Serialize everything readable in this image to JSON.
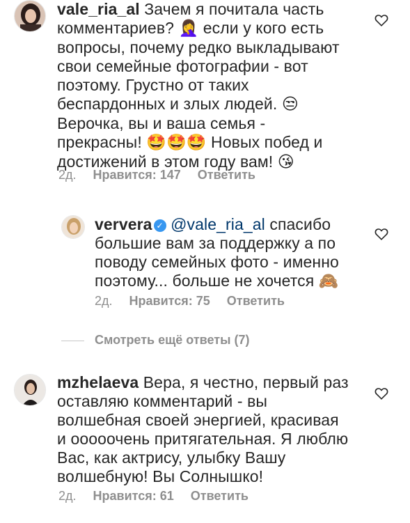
{
  "comments": [
    {
      "username": "vale_ria_al",
      "lines": [
        " Зачем я почитала часть",
        "комментариев? ",
        "вопросы, почему редко выкладывают",
        "свои семейные фотографии - вот",
        "поэтому. Грустно от таких",
        "беспардонных и злых людей. ",
        "Верочка, вы и ваша семья -",
        "прекрасны! ",
        "достижений в этом году вам! "
      ],
      "inline": {
        "line2_after_emoji": " если у кого есть",
        "line8_after_emoji": " Новых побед и"
      },
      "emojis": {
        "facepalm": "🤦‍♀️",
        "unamused": "😒",
        "starstruck": "🤩",
        "kiss": "😘"
      },
      "meta": {
        "time": "2д.",
        "likes": "Нравится: 147",
        "reply": "Ответить"
      }
    },
    {
      "username": "ververa",
      "mention": "@vale_ria_al",
      "lines": [
        " спасибо",
        "большие вам за поддержку  а по",
        "поводу семейных фото - именно",
        "поэтому... больше не хочется "
      ],
      "emojis": {
        "monkey": "🙈"
      },
      "meta": {
        "time": "2д.",
        "likes": "Нравится: 75",
        "reply": "Ответить"
      }
    },
    {
      "username": "mzhelaeva",
      "lines": [
        " Вера, я честно, первый раз",
        "оставляю комментарий - вы",
        "волшебная своей энергией, красивая",
        "и ооооочень притягательная. Я люблю",
        "Вас, как актрису, улыбку Вашу",
        "волшебную! Вы Солнышко!"
      ],
      "meta": {
        "time": "2д.",
        "likes": "Нравится: 61",
        "reply": "Ответить"
      }
    }
  ],
  "view_more": "Смотреть ещё ответы (7)",
  "colors": {
    "text": "#262626",
    "meta": "#8e8e8e",
    "mention": "#00376b",
    "verified": "#3897f0"
  }
}
